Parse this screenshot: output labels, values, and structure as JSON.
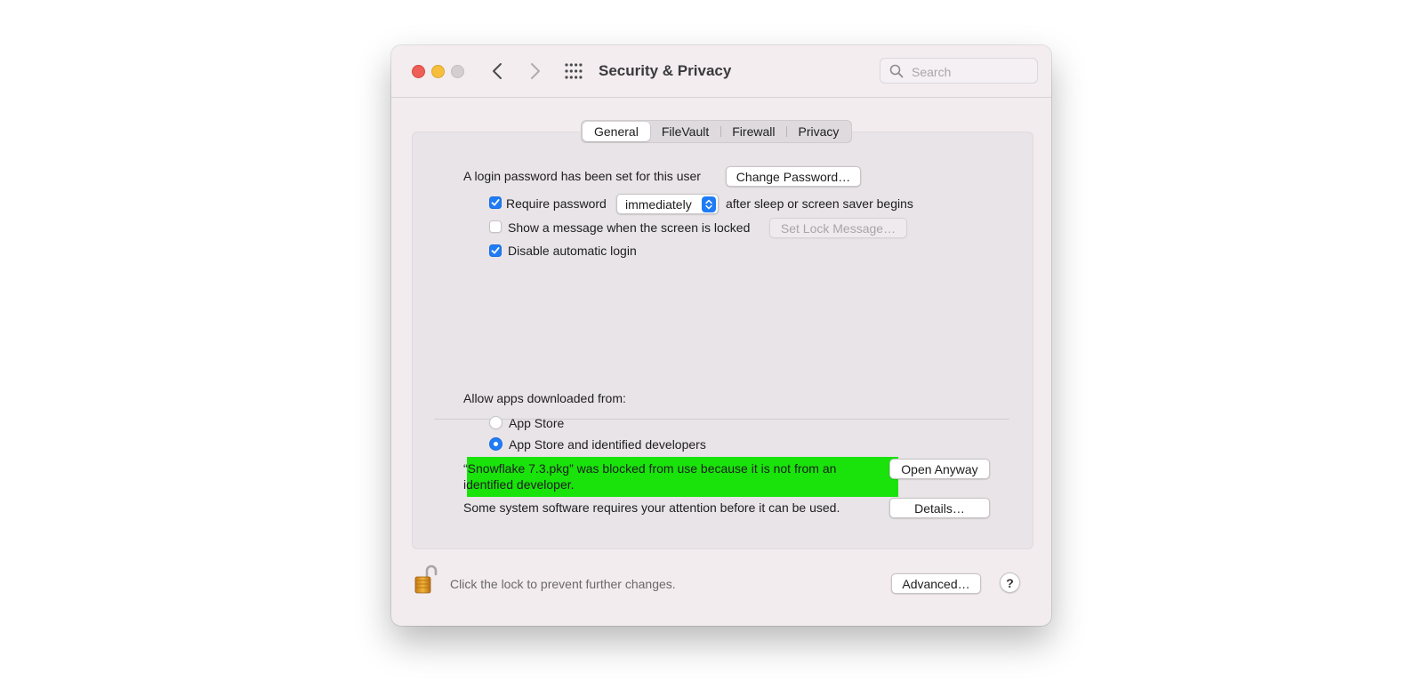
{
  "window": {
    "title": "Security & Privacy",
    "search_placeholder": "Search"
  },
  "tabs": [
    "General",
    "FileVault",
    "Firewall",
    "Privacy"
  ],
  "active_tab": "General",
  "general": {
    "login_password_text": "A login password has been set for this user",
    "change_password_label": "Change Password…",
    "require_password_label": "Require password",
    "require_password_checked": true,
    "require_password_delay": "immediately",
    "after_sleep_text": "after sleep or screen saver begins",
    "show_message_label": "Show a message when the screen is locked",
    "show_message_checked": false,
    "set_lock_message_label": "Set Lock Message…",
    "disable_auto_login_label": "Disable automatic login",
    "disable_auto_login_checked": true
  },
  "apps": {
    "allow_heading": "Allow apps downloaded from:",
    "options": [
      {
        "label": "App Store",
        "selected": false
      },
      {
        "label": "App Store and identified developers",
        "selected": true
      }
    ],
    "blocked_line1": "“Snowflake 7.3.pkg” was blocked from use because it is not from an",
    "blocked_line2": "identified developer.",
    "open_anyway_label": "Open Anyway",
    "system_software_text": "Some system software requires your attention before it can be used.",
    "details_label": "Details…"
  },
  "footer": {
    "lock_text": "Click the lock to prevent further changes.",
    "advanced_label": "Advanced…",
    "help_label": "?"
  },
  "colors": {
    "accent": "#1f7cf5",
    "highlight": "#19e30b"
  }
}
